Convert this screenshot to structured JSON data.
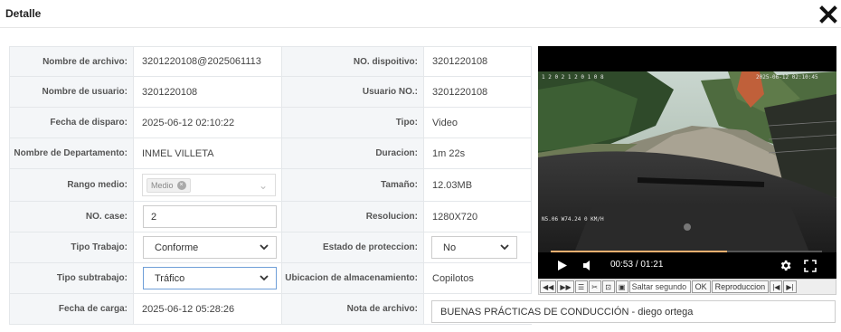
{
  "header": {
    "title": "Detalle"
  },
  "fields": {
    "file_name": {
      "label": "Nombre de archivo:",
      "value": "3201220108@2025061113"
    },
    "device_no": {
      "label": "NO. dispoitivo:",
      "value": "3201220108"
    },
    "user_name": {
      "label": "Nombre de usuario:",
      "value": "3201220108"
    },
    "user_no": {
      "label": "Usuario NO.:",
      "value": "3201220108"
    },
    "trigger_date": {
      "label": "Fecha de disparo:",
      "value": "2025-06-12 02:10:22"
    },
    "type": {
      "label": "Tipo:",
      "value": "Video"
    },
    "department": {
      "label": "Nombre de Departamento:",
      "value": "INMEL VILLETA"
    },
    "duration": {
      "label": "Duracion:",
      "value": "1m 22s"
    },
    "range": {
      "label": "Rango medio:",
      "chip": "Medio"
    },
    "size": {
      "label": "Tamaño:",
      "value": "12.03MB"
    },
    "case_no": {
      "label": "NO. case:",
      "value": "2"
    },
    "resolution": {
      "label": "Resolucion:",
      "value": "1280X720"
    },
    "work_type": {
      "label": "Tipo Trabajo:",
      "value": "Conforme"
    },
    "protection": {
      "label": "Estado de proteccion:",
      "value": "No"
    },
    "work_subtype": {
      "label": "Tipo subtrabajo:",
      "value": "Tráfico"
    },
    "storage": {
      "label": "Ubicacion de almacenamiento:",
      "value": "Copilotos"
    },
    "upload_date": {
      "label": "Fecha de carga:",
      "value": "2025-06-12 05:28:26"
    },
    "file_note": {
      "label": "Nota de archivo:",
      "value": "BUENAS PRÁCTICAS DE CONDUCCIÓN - diego ortega"
    }
  },
  "video": {
    "osd_top_left": "1 2 0 2 1 2 0 1 0 8",
    "osd_top_right": "2025-06-12 02:10:45",
    "osd_bottom_left": "N5.06 W74.24 0 KM/H",
    "time": "00:53 / 01:21",
    "progress": 0.65,
    "progress_color": "#f0b070"
  },
  "toolbar": {
    "skip_placeholder": "Saltar segundo",
    "ok_label": "OK",
    "playback_label": "Reproduccion"
  }
}
